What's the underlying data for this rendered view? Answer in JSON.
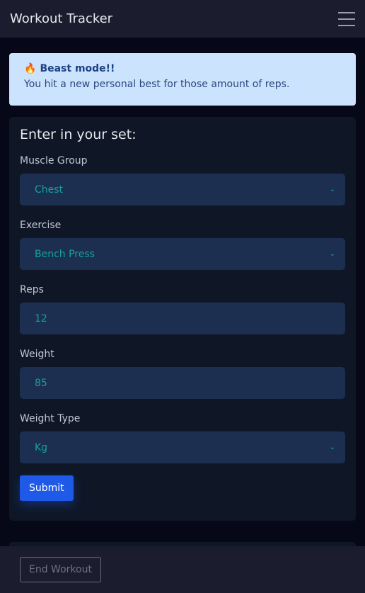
{
  "navbar": {
    "title": "Workout Tracker",
    "menu_icon": "hamburger-icon"
  },
  "alert": {
    "icon": "fire-icon",
    "title": "Beast mode!!",
    "message": "You hit a new personal best for those amount of reps."
  },
  "form": {
    "heading": "Enter in your set:",
    "muscle_group": {
      "label": "Muscle Group",
      "value": "Chest"
    },
    "exercise": {
      "label": "Exercise",
      "value": "Bench Press"
    },
    "reps": {
      "label": "Reps",
      "value": "12"
    },
    "weight": {
      "label": "Weight",
      "value": "85"
    },
    "weight_type": {
      "label": "Weight Type",
      "value": "Kg"
    },
    "submit_label": "Submit"
  },
  "footer": {
    "end_label": "End Workout"
  }
}
